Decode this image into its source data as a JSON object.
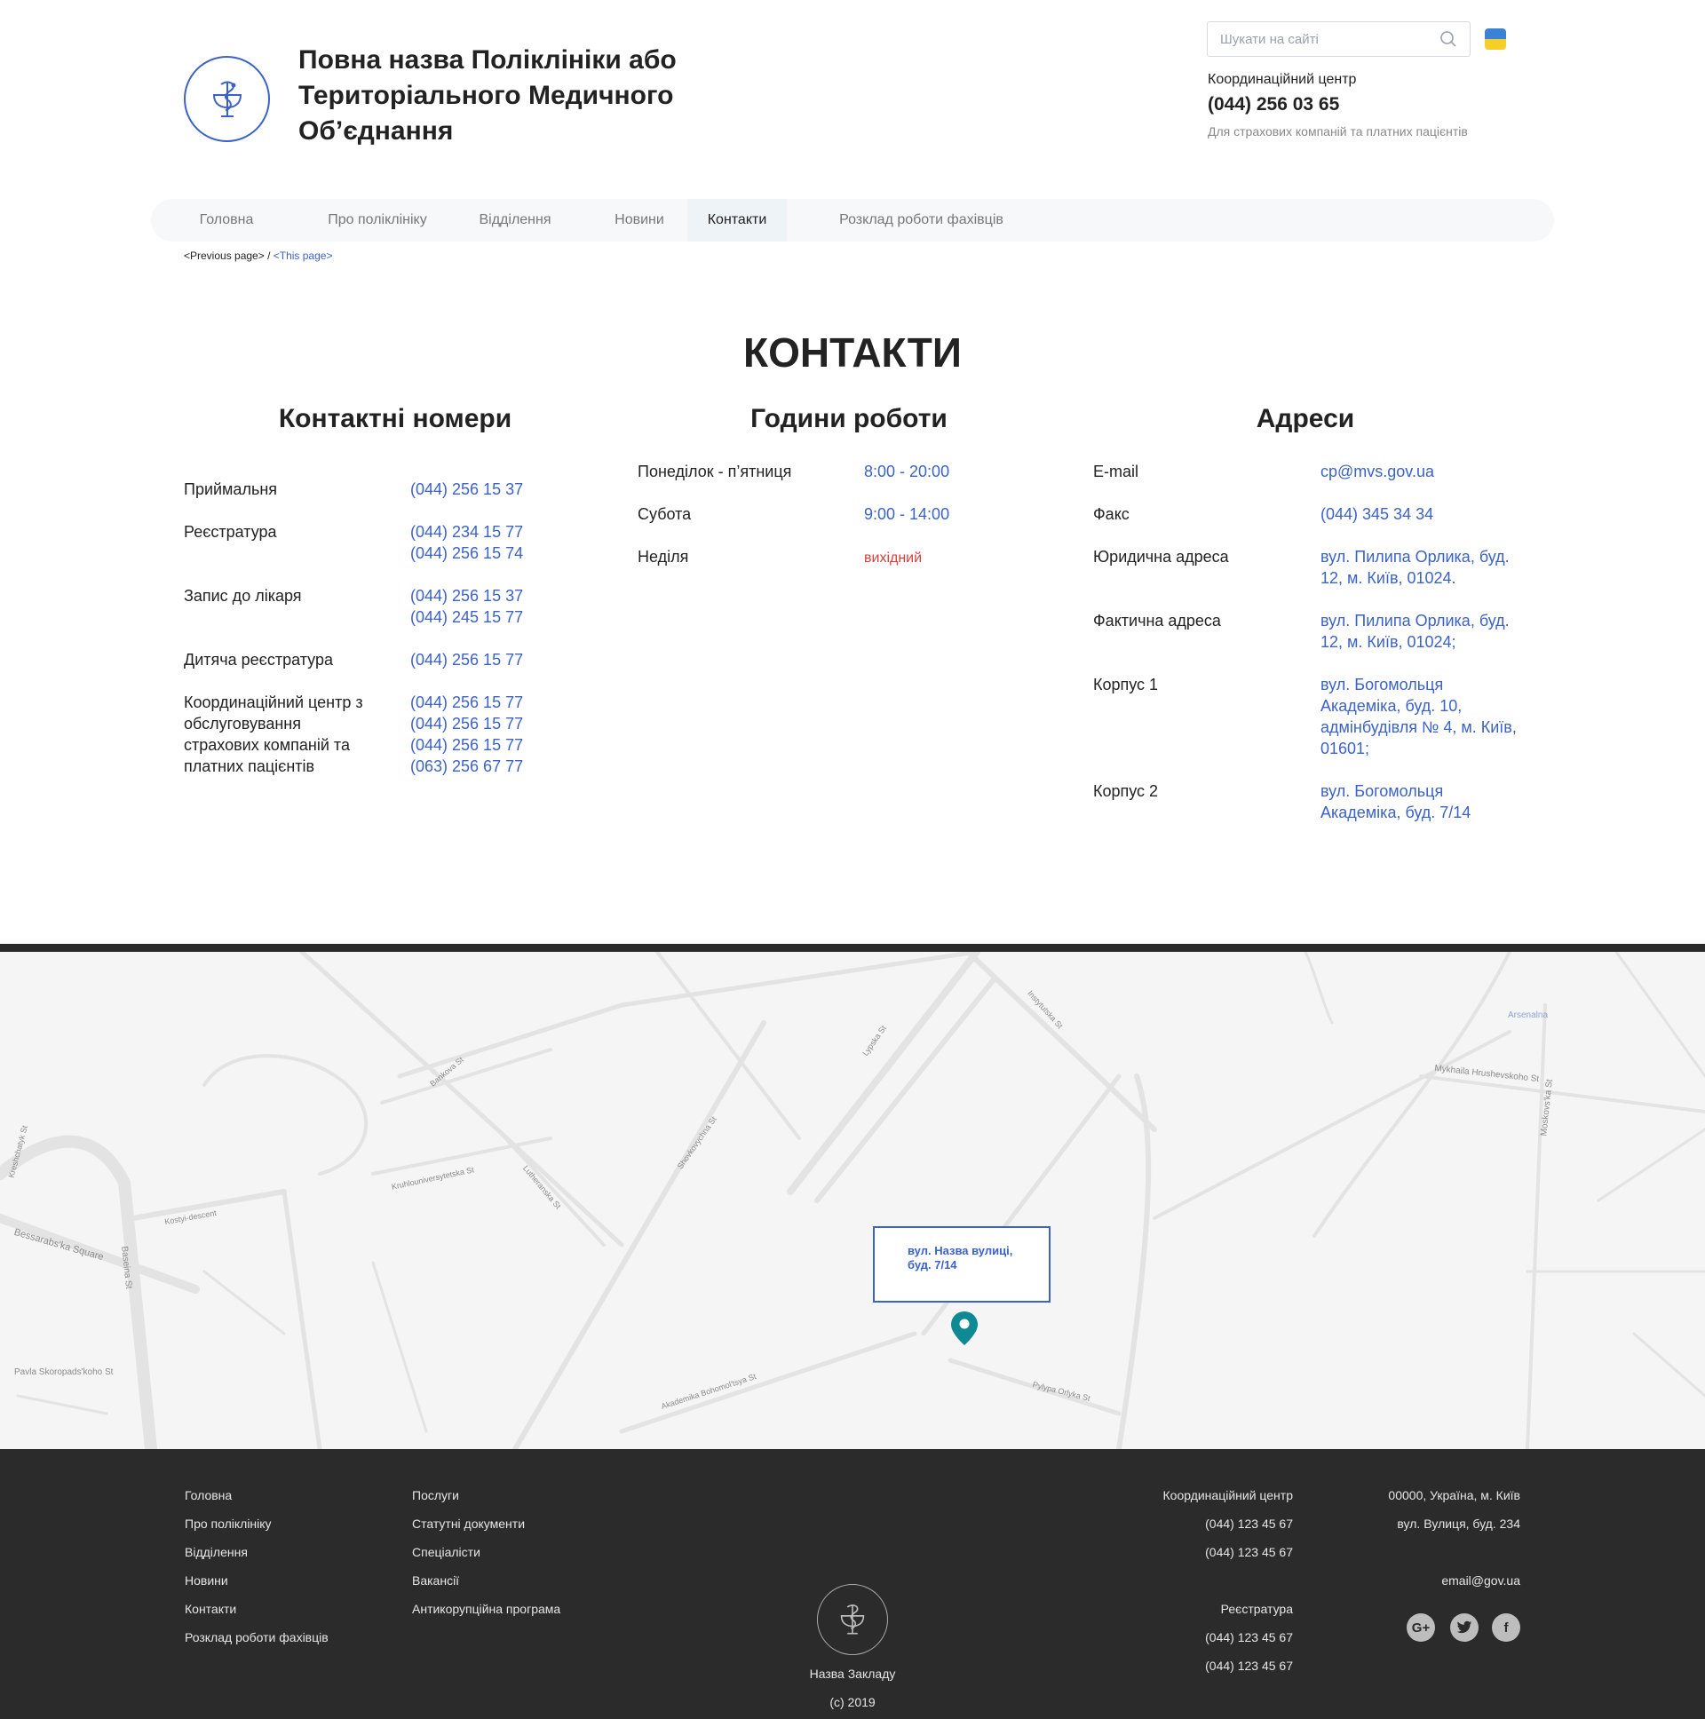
{
  "header": {
    "org_title": "Повна назва Поліклініки або Територіального Медичного Об’єднання",
    "search_placeholder": "Шукати на сайті",
    "coord_label": "Координаційний центр",
    "coord_phone": "(044) 256 03 65",
    "coord_note": "Для страхових компаній та платних пацієнтів"
  },
  "nav": {
    "items": [
      "Головна",
      "Про поліклініку",
      "Відділення",
      "Новини",
      "Контакти",
      "Розклад роботи фахівців"
    ],
    "active": "Контакти"
  },
  "breadcrumb": {
    "prev": "<Previous page>",
    "sep": " / ",
    "current": "<This page>"
  },
  "contacts": {
    "title": "КОНТАКТИ",
    "phones": {
      "title": "Контактні номери",
      "rows": [
        {
          "label": "Приймальня",
          "values": [
            "(044) 256 15 37"
          ]
        },
        {
          "label": "Реєстратура",
          "values": [
            "(044) 234 15 77",
            "(044) 256 15 74"
          ]
        },
        {
          "label": "Запис до лікаря",
          "values": [
            "(044) 256 15 37",
            "(044) 245 15 77"
          ]
        },
        {
          "label": "Дитяча реєстратура",
          "values": [
            "(044) 256 15 77"
          ]
        },
        {
          "label_lines": [
            "Координаційний центр з",
            "обслуговування",
            "страхових компаній та",
            "платних пацієнтів"
          ],
          "values": [
            "(044) 256 15 77",
            "(044) 256 15 77",
            "(044) 256 15 77",
            "(063) 256 67 77"
          ]
        }
      ]
    },
    "hours": {
      "title": "Години роботи",
      "rows": [
        {
          "label": "Понеділок - п’ятниця",
          "value": "8:00 - 20:00"
        },
        {
          "label": "Субота",
          "value": "9:00 - 14:00"
        },
        {
          "label": "Неділя",
          "value": "вихідний"
        }
      ]
    },
    "addresses": {
      "title": "Адреси",
      "rows": [
        {
          "label": "E-mail",
          "lines": [
            "cp@mvs.gov.ua"
          ]
        },
        {
          "label": "Факс",
          "lines": [
            "(044) 345 34 34"
          ]
        },
        {
          "label": "Юридична адреса",
          "lines": [
            "вул. Пилипа Орлика, буд.",
            "12, м. Київ, 01024."
          ]
        },
        {
          "label": "Фактична адреса",
          "lines": [
            "вул. Пилипа Орлика, буд.",
            "12, м. Київ, 01024;"
          ]
        },
        {
          "label": "Корпус 1",
          "lines": [
            "вул. Богомольця",
            "Академіка, буд. 10,",
            "адмінбудівля № 4, м. Київ,",
            "01601;"
          ]
        },
        {
          "label": "Корпус 2",
          "lines": [
            "вул. Богомольця",
            "Академіка, буд. 7/14"
          ]
        }
      ]
    }
  },
  "map": {
    "popup_lines": [
      "вул. Назва вулиці,",
      "буд. 7/14"
    ],
    "pin_color": "#0f8a94",
    "labels": [
      "Bessarabs'ka Square",
      "Baseina St",
      "Pavla Skoropads'koho St",
      "Mykhaila Hrushevskoho St",
      "Moskovs'ka St",
      "Arsenalna",
      "Akademika Bohomol'tsya St",
      "Pylypa Orlyka St",
      "Lypska St",
      "Instytutska St",
      "Shovkovychna St",
      "Kruhlouniversytetska St",
      "Lutheranska St",
      "Kostyi-descent",
      "Bankova St",
      "Kreshchatyk St"
    ]
  },
  "footer": {
    "col1": [
      "Головна",
      "Про поліклініку",
      "Відділення",
      "Новини",
      "Контакти",
      "Розклад роботи фахівців"
    ],
    "col2": [
      "Послуги",
      "Статутні документи",
      "Спеціалісти",
      "Вакансії",
      "Антикорупційна програма"
    ],
    "coord": [
      "Координаційний центр",
      "(044) 123 45 67",
      "(044) 123 45 67"
    ],
    "registry": [
      "Реєстратура",
      "(044) 123 45 67",
      "(044) 123 45 67"
    ],
    "address": [
      "00000, Україна, м. Київ",
      "вул. Вулиця, буд. 234"
    ],
    "email": "email@gov.ua",
    "org_name": "Назва Закладу",
    "copyright": "(c) 2019",
    "social": [
      "G+",
      "twitter-icon",
      "f"
    ]
  },
  "colors": {
    "accent": "#3b62c9",
    "danger": "#d9403a",
    "footer_bg": "#2b2b2c"
  }
}
